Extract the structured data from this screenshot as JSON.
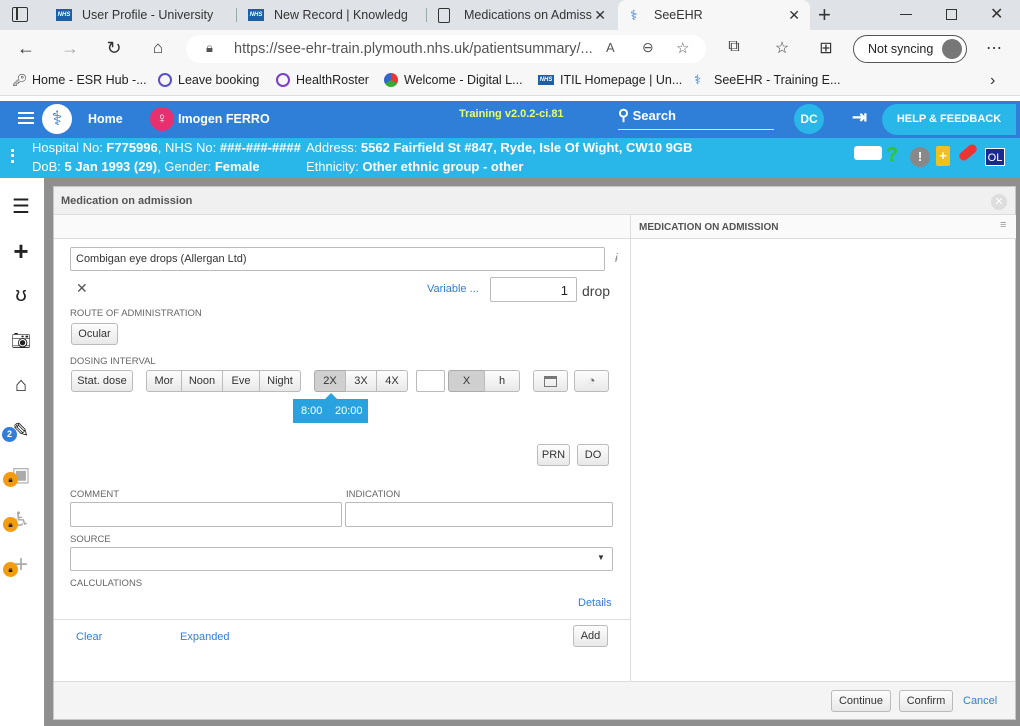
{
  "browser": {
    "tabs": [
      {
        "title": "User Profile - University"
      },
      {
        "title": "New Record | Knowledg"
      },
      {
        "title": "Medications on Admiss"
      },
      {
        "title": "SeeEHR"
      }
    ],
    "url": "https://see-ehr-train.plymouth.nhs.uk/patientsummary/...",
    "sync_label": "Not syncing",
    "bookmarks": [
      {
        "label": "Home - ESR Hub -..."
      },
      {
        "label": "Leave booking"
      },
      {
        "label": "HealthRoster"
      },
      {
        "label": "Welcome - Digital L..."
      },
      {
        "label": "ITIL Homepage | Un..."
      },
      {
        "label": "SeeEHR - Training E..."
      }
    ]
  },
  "app": {
    "home_label": "Home",
    "patient_name": "Imogen FERRO",
    "version": "Training v2.0.2-ci.81",
    "search_label": "Search",
    "user_initials": "DC",
    "help_label": "HELP & FEEDBACK",
    "badge_ol": "OL"
  },
  "patient": {
    "hospital_prefix": "Hospital No: ",
    "hospital_no": "F775996",
    "nhs_prefix": ", NHS No: ",
    "nhs_no": "###-###-####",
    "dob_prefix": "DoB: ",
    "dob": "5 Jan 1993 (29)",
    "gender_prefix": ", Gender: ",
    "gender": "Female",
    "address_prefix": "Address: ",
    "address": "5562 Fairfield St #847, Ryde, Isle Of Wight, CW10 9GB",
    "ethnicity_prefix": "Ethnicity: ",
    "ethnicity": "Other ethnic group - other"
  },
  "rail": {
    "tasks_badge": "2"
  },
  "modal": {
    "title": "Medication on admission",
    "right_title": "MEDICATION ON ADMISSION",
    "drug": "Combigan eye drops (Allergan Ltd)",
    "variable_link": "Variable ...",
    "dose_value": "1",
    "dose_unit": "drop",
    "route_label": "ROUTE OF ADMINISTRATION",
    "route_value": "Ocular",
    "dosing_label": "DOSING INTERVAL",
    "stat_dose": "Stat. dose",
    "times_of_day": [
      "Mor",
      "Noon",
      "Eve",
      "Night"
    ],
    "frequencies": [
      "2X",
      "3X",
      "4X"
    ],
    "selected_frequency": "2X",
    "custom_x": "X",
    "custom_h": "h",
    "times": [
      "8:00",
      "20:00"
    ],
    "prn": "PRN",
    "do": "DO",
    "comment_label": "COMMENT",
    "indication_label": "INDICATION",
    "source_label": "SOURCE",
    "calculations_label": "CALCULATIONS",
    "details_link": "Details",
    "clear_link": "Clear",
    "expanded_link": "Expanded",
    "add_button": "Add",
    "continue_button": "Continue",
    "confirm_button": "Confirm",
    "cancel_link": "Cancel"
  },
  "colors": {
    "app_header": "#2f7ed8",
    "patient_bar": "#29b6e8",
    "time_chip": "#29a3e0",
    "link": "#2f7ed8"
  }
}
